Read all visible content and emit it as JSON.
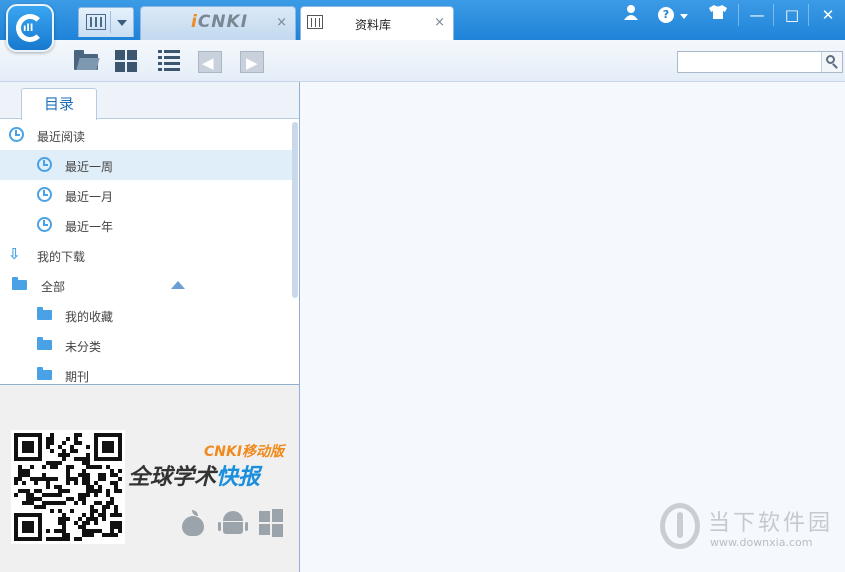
{
  "window": {
    "tabs": [
      {
        "label": "CNKI"
      },
      {
        "label": "资料库"
      }
    ],
    "close_glyph": "×",
    "controls": {
      "minimize": "—",
      "maximize": "□",
      "close": "✕",
      "help": "?"
    }
  },
  "toolbar": {
    "search": {
      "value": "",
      "placeholder": ""
    }
  },
  "sidebar": {
    "tab_label": "目录",
    "items": [
      {
        "label": "最近阅读",
        "icon": "clock-icon"
      },
      {
        "label": "最近一周",
        "icon": "clock-icon"
      },
      {
        "label": "最近一月",
        "icon": "clock-icon"
      },
      {
        "label": "最近一年",
        "icon": "clock-icon"
      },
      {
        "label": "我的下载",
        "icon": "download-icon"
      },
      {
        "label": "全部",
        "icon": "folder-icon"
      },
      {
        "label": "我的收藏",
        "icon": "folder-icon"
      },
      {
        "label": "未分类",
        "icon": "folder-icon"
      },
      {
        "label": "期刊",
        "icon": "folder-icon"
      }
    ],
    "promo": {
      "brand": "CNKI移动版",
      "title_part1": "全球学术",
      "title_part2": "快报"
    }
  },
  "watermark": {
    "text": "当下软件园",
    "url": "www.downxia.com"
  },
  "colors": {
    "titlebar": "#1f83d8",
    "accent": "#4aa2e6",
    "selection": "#dfeef9",
    "brand_orange": "#f08a1c"
  }
}
